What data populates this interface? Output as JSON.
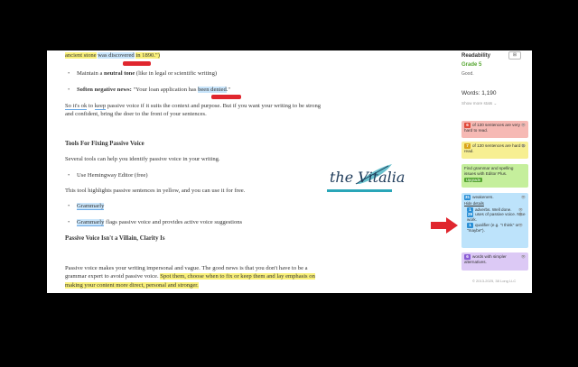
{
  "editor": {
    "line_top_fragment": "ancient stone",
    "line_top_highlight": "was discovered",
    "line_top_tail": "in 1890.\")",
    "bullet_neutral_pre": "Maintain a ",
    "bullet_neutral_bold": "neutral tone",
    "bullet_neutral_post": " (like in legal or scientific writing)",
    "bullet_soften_bold": "Soften negative news:",
    "bullet_soften_pre": " \"Your loan application has ",
    "bullet_soften_highlight": "been denied",
    "bullet_soften_post": ".\"",
    "para_ok_a": "So it's ok",
    "para_ok_b": " to ",
    "para_ok_c": "keep",
    "para_ok_d": " passive voice if it suits the context and purpose. But if you want your writing to be strong and confident, bring the doer to the front of your sentences.",
    "heading_tools": "Tools For Fixing Passive Voice",
    "para_tools": "Several tools can help you identify passive voice in your writing.",
    "bullet_hemingway": "Use Hemingway Editor (free)",
    "para_hemingway": "This tool highlights passive sentences in yellow, and you can use it for free.",
    "bullet_grammarly": "Grammarly",
    "bullet_grammarly2_link": "Grammarly",
    "bullet_grammarly2_rest": " flags passive voice and provides active voice suggestions",
    "heading_villain": "Passive Voice Isn't a Villain, Clarity Is",
    "para_final_a": "Passive voice makes your writing impersonal and vague. The good news is that you don't have to be a grammar expert to avoid passive voice. ",
    "para_final_highlight": "Spot them, choose when to fix or keep them and lay emphasis on making your content more direct, personal and stronger."
  },
  "logo": {
    "text": "the Vitalia",
    "colors": {
      "text": "#1e3b5a",
      "accent": "#2aa6b8"
    }
  },
  "sidebar": {
    "readability_label": "Readability",
    "grade": "Grade 5",
    "grade_desc": "Good.",
    "words": "Words: 1,190",
    "more_stats": "Show more stats",
    "cards": [
      {
        "num": "6",
        "text": "of 130 sentences are very hard to read.",
        "color": "#e14b3b"
      },
      {
        "num": "7",
        "text": "of 130 sentences are hard to read.",
        "color": "#d9a51c"
      },
      {
        "num": "",
        "text": "Find grammar and spelling issues with Editor Plus.",
        "button": "Upgrade",
        "color": "#55a630"
      },
      {
        "num": "31",
        "text": "weakeners.",
        "link": "Hide details",
        "color": "#2a8fd6",
        "sub": [
          {
            "num": "1",
            "text": "adverbs. Well done."
          },
          {
            "num": "29",
            "text": "uses of passive voice. Nice work."
          },
          {
            "num": "1",
            "text": "qualifier (e.g. \"I think\" or \"maybe\")."
          }
        ]
      },
      {
        "num": "6",
        "text": "words with simpler alternatives.",
        "color": "#8a5cd6"
      }
    ],
    "footer": "© 2013-2025, 38 Long LLC"
  },
  "colors": {
    "arrow": "#e0262e",
    "highlight_yellow": "#f9f07a",
    "highlight_blue": "#c9e5fb"
  }
}
